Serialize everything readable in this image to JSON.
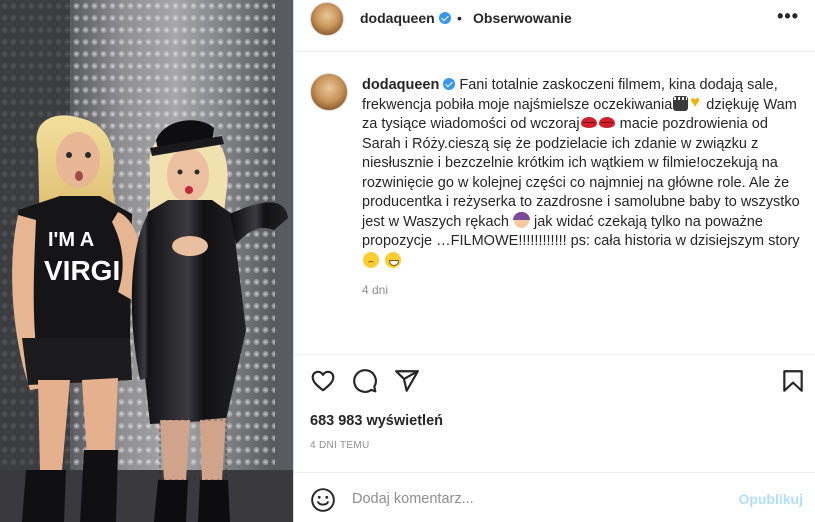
{
  "header": {
    "username": "dodaqueen",
    "separator": "•",
    "follow_label": "Obserwowanie",
    "more_icon": "more-horizontal-icon"
  },
  "caption": {
    "username": "dodaqueen",
    "segments": [
      "Fani totalnie zaskoczeni filmem, kina dodają sale, frekwencja pobiła moje najśmielsze oczekiwania",
      "dziękuję Wam za tysiące wiadomości od wczoraj",
      "macie pozdrowienia od Sarah i Róży.cieszą się że podzielacie ich zdanie w związku z niesłusznie i bezczelnie krótkim ich wątkiem w filmie!oczekują na rozwinięcie go w kolejnej części co najmniej na główne role. Ale że producentka i reżyserka to zazdrosne i samolubne baby to wszystko jest w Waszych rękach",
      "jak widać czekają tylko na poważne propozycje …FILMOWE!!!!!!!!!!!! ps: cała historia w dzisiejszym story"
    ],
    "emoji": [
      "clapper-board-emoji",
      "yellow-heart-emoji",
      "lips-emoji",
      "lips-emoji",
      "woman-gesturing-emoji",
      "frowning-face-emoji",
      "grinning-sweat-emoji"
    ],
    "time_ago": "4 dni"
  },
  "actions": {
    "like_icon": "heart-icon",
    "comment_icon": "comment-icon",
    "share_icon": "share-icon",
    "save_icon": "bookmark-icon"
  },
  "stats": {
    "views_count": "683 983",
    "views_label": "wyświetleń",
    "date_label": "4 DNI TEMU"
  },
  "comment": {
    "placeholder": "Dodaj komentarz...",
    "publish_label": "Opublikuj",
    "emoji_icon": "smiley-icon"
  },
  "media": {
    "shirt_text_line1": "I'M A",
    "shirt_text_line2": "VIRGI"
  },
  "colors": {
    "verified": "#3897f0",
    "publish_disabled": "#b2dffc",
    "muted_text": "#8e8e8e",
    "text": "#262626"
  }
}
